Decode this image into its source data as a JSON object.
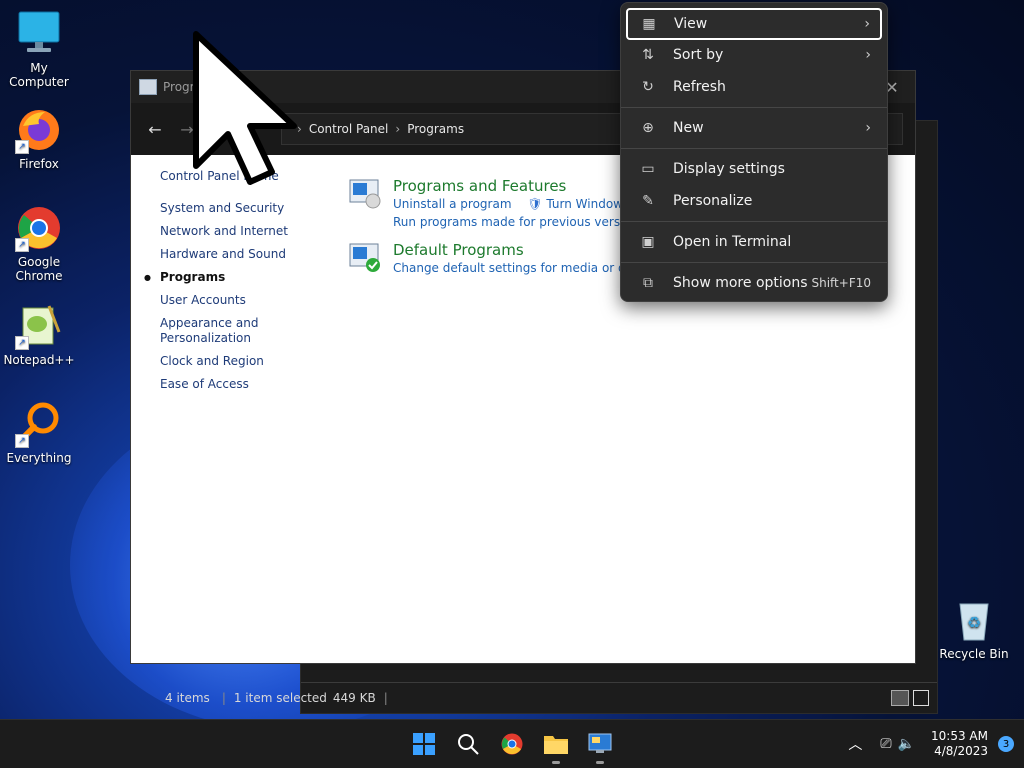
{
  "desktop": {
    "icons": [
      {
        "label": "My Computer"
      },
      {
        "label": "Firefox"
      },
      {
        "label": "Google Chrome"
      },
      {
        "label": "Notepad++"
      },
      {
        "label": "Everything"
      },
      {
        "label": "Recycle Bin"
      }
    ]
  },
  "window": {
    "title": "Programs",
    "breadcrumb": [
      "Control Panel",
      "Programs"
    ]
  },
  "sidebar": {
    "home": "Control Panel Home",
    "items": [
      "System and Security",
      "Network and Internet",
      "Hardware and Sound",
      "Programs",
      "User Accounts",
      "Appearance and Personalization",
      "Clock and Region",
      "Ease of Access"
    ],
    "current": "Programs"
  },
  "sections": [
    {
      "title": "Programs and Features",
      "links": [
        "Uninstall a program",
        "Turn Windows fe"
      ],
      "line2": "Run programs made for previous versions o"
    },
    {
      "title": "Default Programs",
      "links": [
        "Change default settings for media or device"
      ]
    }
  ],
  "background_window": {
    "status": {
      "items": "4 items",
      "selected": "1 item selected",
      "size": "449 KB"
    }
  },
  "context_menu": {
    "items": [
      {
        "label": "View",
        "icon": "view-grid-icon",
        "submenu": true,
        "selected": true
      },
      {
        "label": "Sort by",
        "icon": "sort-icon",
        "submenu": true
      },
      {
        "label": "Refresh",
        "icon": "refresh-icon"
      },
      {
        "label": "New",
        "icon": "new-plus-icon",
        "submenu": true
      },
      {
        "label": "Display settings",
        "icon": "display-settings-icon"
      },
      {
        "label": "Personalize",
        "icon": "personalize-pen-icon"
      },
      {
        "label": "Open in Terminal",
        "icon": "terminal-icon"
      },
      {
        "label": "Show more options",
        "icon": "more-options-icon",
        "shortcut": "Shift+F10"
      }
    ]
  },
  "taskbar": {
    "time": "10:53 AM",
    "date": "4/8/2023",
    "notification_count": "3",
    "accent": "#4aa8ff"
  }
}
